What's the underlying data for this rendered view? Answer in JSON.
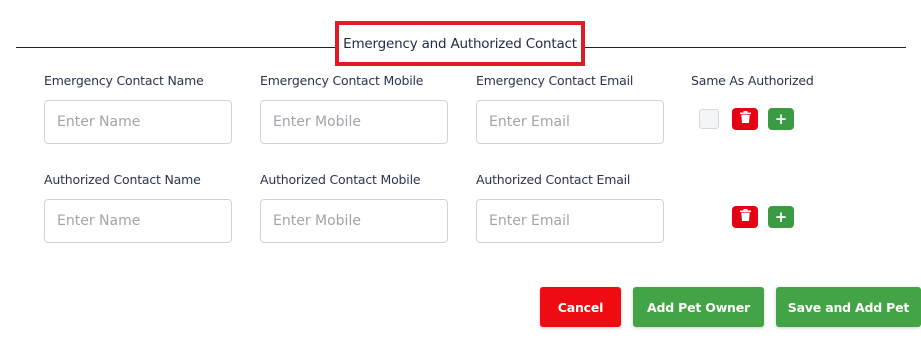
{
  "section": {
    "title": "Emergency and Authorized Contact"
  },
  "emergency": {
    "name_label": "Emergency Contact Name",
    "name_placeholder": "Enter Name",
    "mobile_label": "Emergency Contact Mobile",
    "mobile_placeholder": "Enter Mobile",
    "email_label": "Emergency Contact Email",
    "email_placeholder": "Enter Email",
    "same_as_label": "Same As Authorized",
    "same_as_checked": false
  },
  "authorized": {
    "name_label": "Authorized Contact Name",
    "name_placeholder": "Enter Name",
    "mobile_label": "Authorized Contact Mobile",
    "mobile_placeholder": "Enter Mobile",
    "email_label": "Authorized Contact Email",
    "email_placeholder": "Enter Email"
  },
  "icons": {
    "delete": "trash-icon",
    "add": "plus-icon",
    "add_glyph": "+"
  },
  "colors": {
    "highlight_border": "#e01b24",
    "danger": "#e60012",
    "success": "#3a9b43"
  },
  "actions": {
    "cancel_label": "Cancel",
    "add_pet_owner_label": "Add Pet Owner",
    "save_and_add_pet_label": "Save and Add Pet"
  }
}
